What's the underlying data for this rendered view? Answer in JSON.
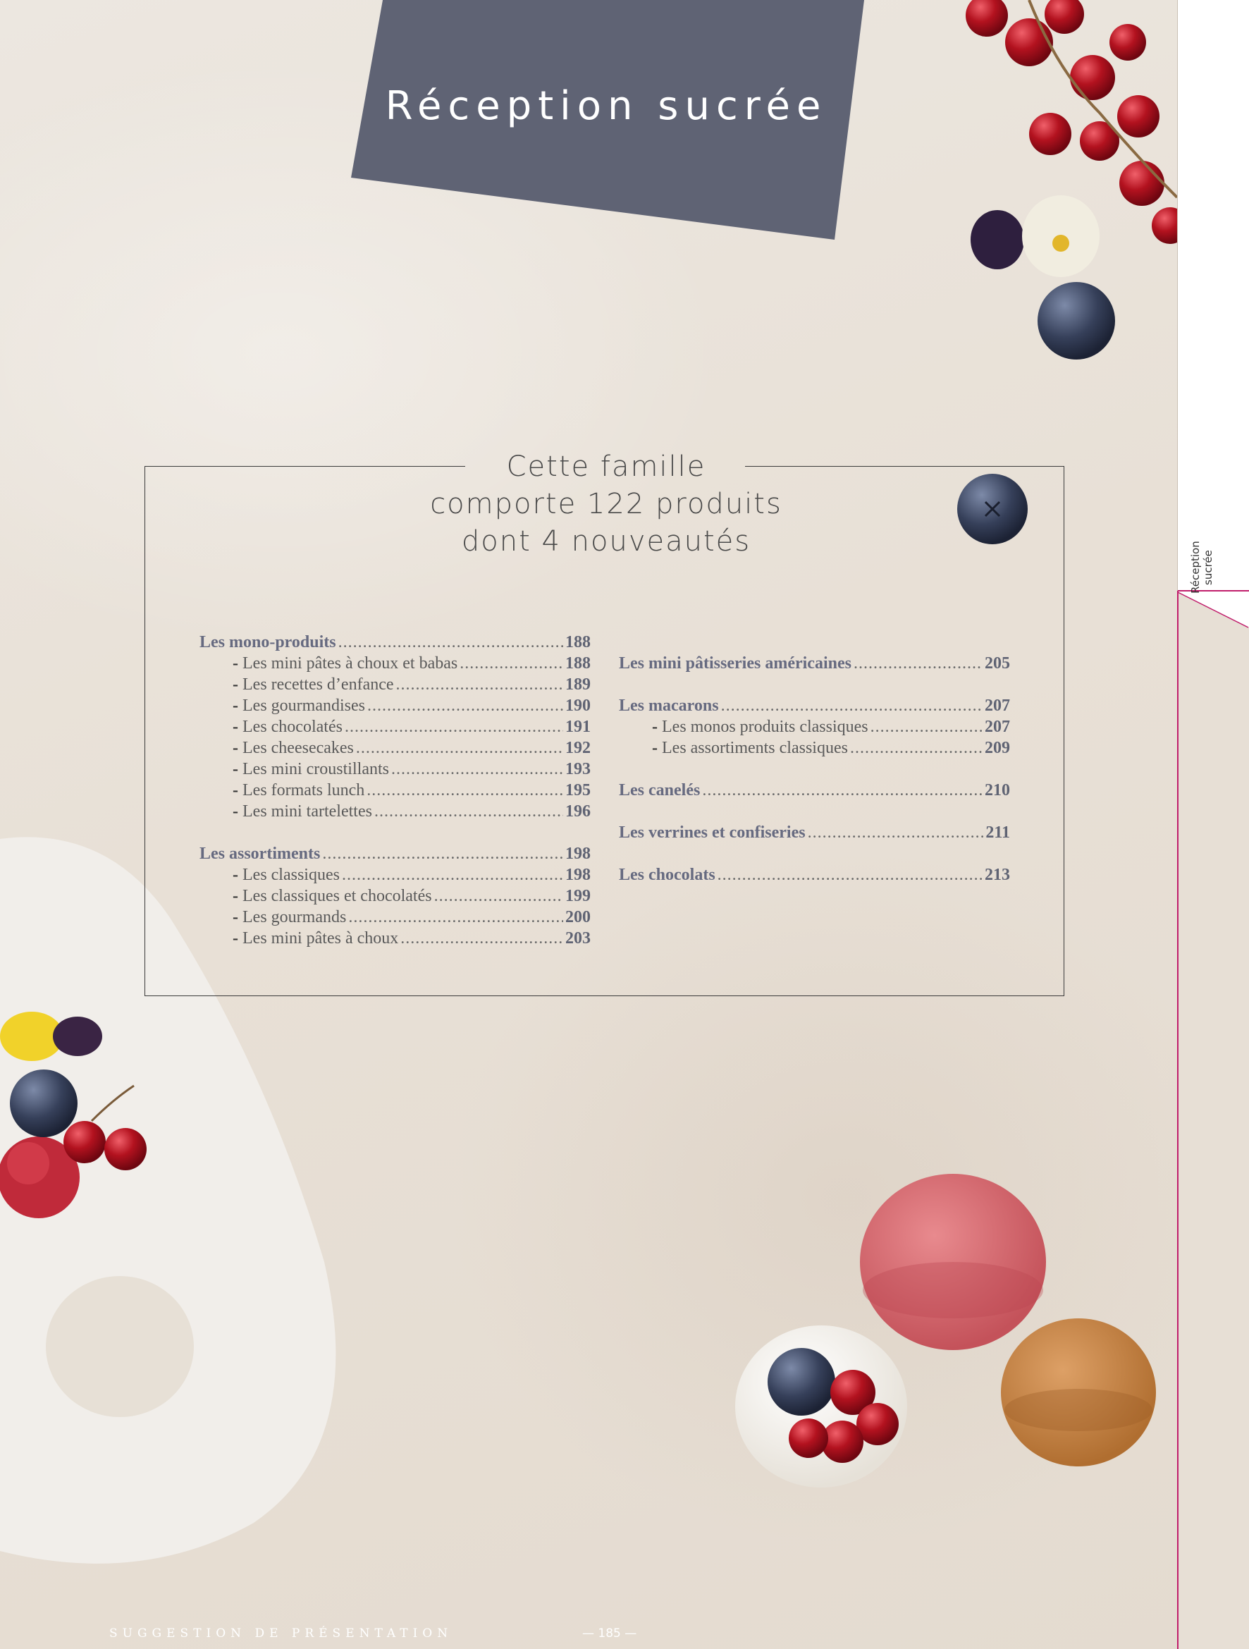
{
  "title": "Réception sucrée",
  "family_info": [
    "Cette famille",
    "comporte 122 produits",
    "dont 4 nouveautés"
  ],
  "side_tab_label": "Réception sucrée",
  "colors": {
    "banner": "#5f6374",
    "accent_line": "#c01d6b",
    "toc_heading": "#666a80"
  },
  "toc_left": [
    {
      "label": "Les mono-produits",
      "page": "188",
      "level": "head"
    },
    {
      "label": "Les mini pâtes à choux et babas",
      "page": "188",
      "level": "sub"
    },
    {
      "label": "Les recettes d’enfance",
      "page": "189",
      "level": "sub"
    },
    {
      "label": "Les gourmandises",
      "page": "190",
      "level": "sub"
    },
    {
      "label": "Les chocolatés",
      "page": "191",
      "level": "sub"
    },
    {
      "label": "Les cheesecakes",
      "page": "192",
      "level": "sub"
    },
    {
      "label": "Les mini croustillants",
      "page": "193",
      "level": "sub"
    },
    {
      "label": "Les formats lunch",
      "page": "195",
      "level": "sub"
    },
    {
      "label": "Les mini tartelettes",
      "page": "196",
      "level": "sub"
    },
    {
      "label": "",
      "page": "",
      "level": "gap"
    },
    {
      "label": "Les assortiments",
      "page": "198",
      "level": "head"
    },
    {
      "label": "Les classiques",
      "page": "198",
      "level": "sub"
    },
    {
      "label": "Les classiques et chocolatés",
      "page": "199",
      "level": "sub"
    },
    {
      "label": "Les gourmands",
      "page": "200",
      "level": "sub"
    },
    {
      "label": "Les mini pâtes à choux",
      "page": "203",
      "level": "sub"
    }
  ],
  "toc_right": [
    {
      "label": "Les mini pâtisseries américaines",
      "page": "205",
      "level": "head"
    },
    {
      "label": "",
      "page": "",
      "level": "gap"
    },
    {
      "label": "Les macarons",
      "page": "207",
      "level": "head"
    },
    {
      "label": "Les monos produits classiques",
      "page": "207",
      "level": "sub"
    },
    {
      "label": "Les assortiments classiques",
      "page": "209",
      "level": "sub"
    },
    {
      "label": "",
      "page": "",
      "level": "gap"
    },
    {
      "label": "Les canelés",
      "page": "210",
      "level": "head"
    },
    {
      "label": "",
      "page": "",
      "level": "gap"
    },
    {
      "label": "Les verrines et confiseries",
      "page": "211",
      "level": "head"
    },
    {
      "label": "",
      "page": "",
      "level": "gap"
    },
    {
      "label": "Les chocolats",
      "page": "213",
      "level": "head"
    }
  ],
  "footer": {
    "note": "SUGGESTION DE PRÉSENTATION",
    "page": "185"
  }
}
